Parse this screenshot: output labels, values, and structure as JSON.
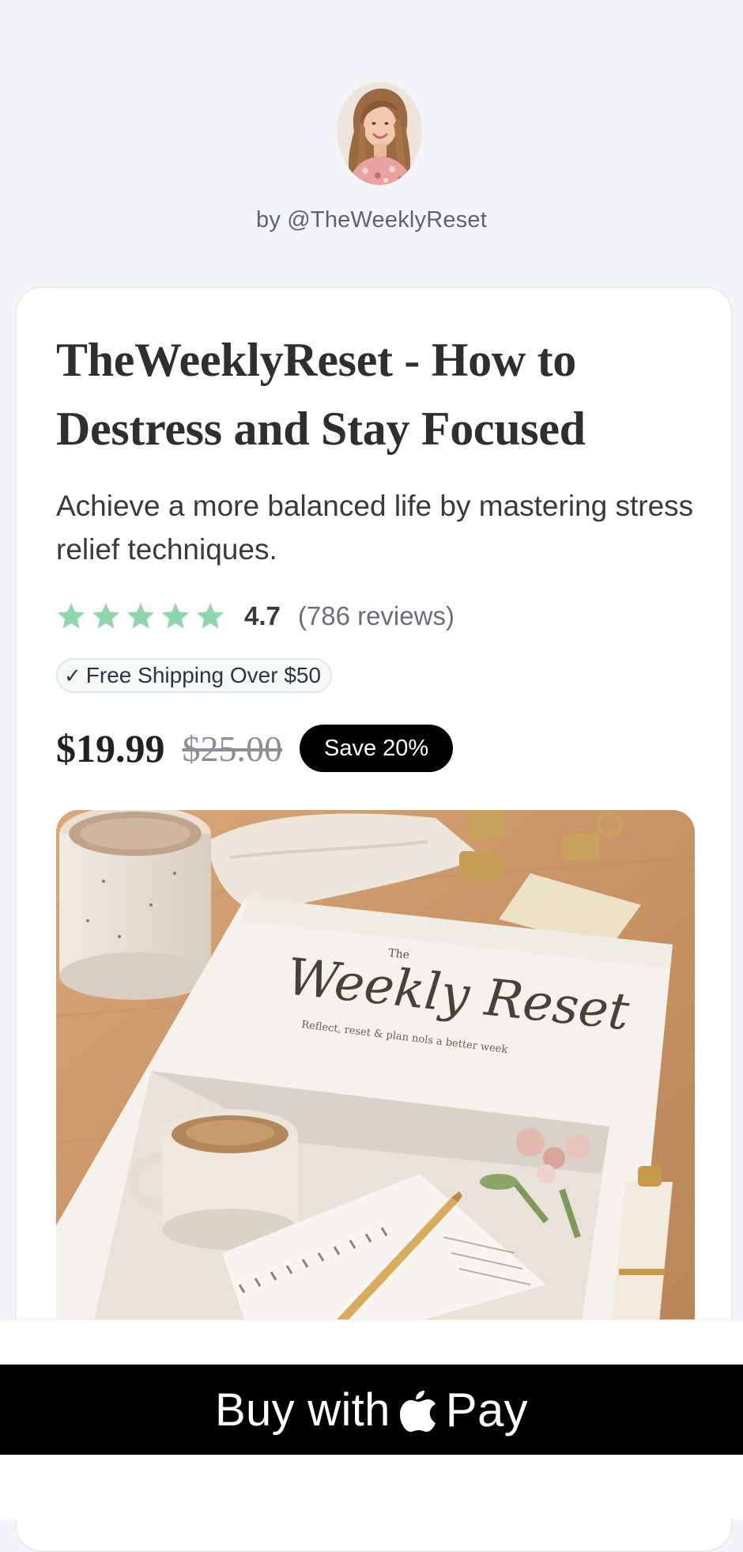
{
  "creator": {
    "byline": "by @TheWeeklyReset",
    "avatar_icon": "creator-avatar-photo"
  },
  "product": {
    "title": "TheWeeklyReset - How to Destress and Stay Focused",
    "subtitle": "Achieve a more balanced life by mastering stress relief techniques.",
    "rating": {
      "stars": 5,
      "value": "4.7",
      "reviews": "(786 reviews)",
      "star_color": "#8fd6ad"
    },
    "shipping": {
      "check": "✓",
      "label": "Free Shipping Over $50"
    },
    "price": {
      "current": "$19.99",
      "original": "$25.00",
      "save_label": "Save 20%"
    },
    "image": {
      "cover_the": "The",
      "cover_title": "Weekly Reset",
      "cover_tagline": "Reflect, reset & plan nols a better week"
    }
  },
  "checkout": {
    "buy_label": "Buy with",
    "pay_label": "Pay",
    "icon": "apple-logo-icon"
  },
  "colors": {
    "accent_star": "#8fd6ad",
    "button_bg": "#000000",
    "page_bg": "#f4f5f9"
  }
}
